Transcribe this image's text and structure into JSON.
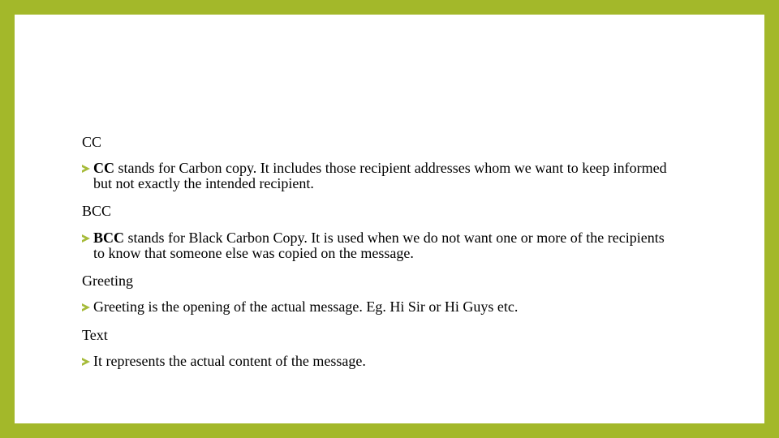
{
  "colors": {
    "frame": "#a3b82a",
    "background": "#ffffff",
    "bullet": "#a6bb3a",
    "text": "#000000"
  },
  "sections": [
    {
      "heading": "CC",
      "bullet": {
        "icon": "arrow-bullet-icon",
        "bold_term": "CC",
        "text": " stands for Carbon copy. It includes those recipient addresses whom we want to keep informed but not exactly the intended recipient."
      }
    },
    {
      "heading": "BCC",
      "bullet": {
        "icon": "arrow-bullet-icon",
        "bold_term": "BCC",
        "text": " stands for Black Carbon Copy. It is used when we do not want one or more of the recipients to know that someone else was copied on the message."
      }
    },
    {
      "heading": "Greeting",
      "bullet": {
        "icon": "arrow-bullet-icon",
        "bold_term": "",
        "text": "Greeting is the opening of the actual message. Eg. Hi Sir or Hi Guys etc."
      }
    },
    {
      "heading": "Text",
      "bullet": {
        "icon": "arrow-bullet-icon",
        "bold_term": "",
        "text": "It represents the actual content of the message."
      }
    }
  ]
}
